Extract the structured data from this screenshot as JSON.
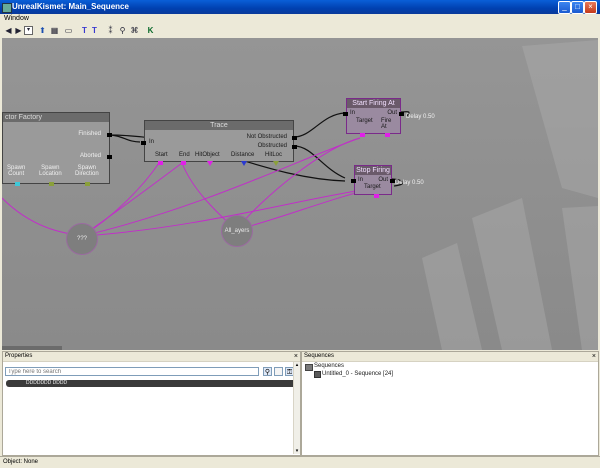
{
  "window": {
    "title": "UnrealKismet: Main_Sequence"
  },
  "menu": {
    "items": [
      "Window"
    ]
  },
  "nodes": {
    "actor_factory": {
      "title": "ctor Factory",
      "out_finished": "Finished",
      "out_aborted": "Aborted",
      "spawn_count": "Spawn\nCount",
      "spawn_location": "Spawn\nLocation",
      "spawn_direction": "Spawn\nDirection"
    },
    "trace": {
      "title": "Trace",
      "in": "In",
      "not_obstructed": "Not Obstructed",
      "obstructed": "Obstructed",
      "vars": [
        "Start",
        "End",
        "HitObject",
        "Distance",
        "HitLoc"
      ]
    },
    "start_firing": {
      "title": "Start Firing At",
      "in": "In",
      "out": "Out",
      "target": "Target",
      "fire_at": "Fire\nAt",
      "delay": "Delay 0.50"
    },
    "stop_firing": {
      "title": "Stop Firing",
      "in": "In",
      "out": "Out",
      "target": "Target",
      "delay": "Delay 0.50"
    }
  },
  "vars": {
    "player": "???",
    "all_players": "All_ayers"
  },
  "properties": {
    "title": "Properties",
    "search_placeholder": "Type here to search",
    "row": "DDDDDDD DDDD"
  },
  "sequences": {
    "title": "Sequences",
    "root": "Sequences",
    "item": "Untitled_0 - Sequence [24]"
  },
  "status": {
    "text": "Object: None"
  },
  "colors": {
    "canvas": "#8c8c8c",
    "action_border": "#7a2a8a",
    "link_magenta": "#c030c8"
  }
}
